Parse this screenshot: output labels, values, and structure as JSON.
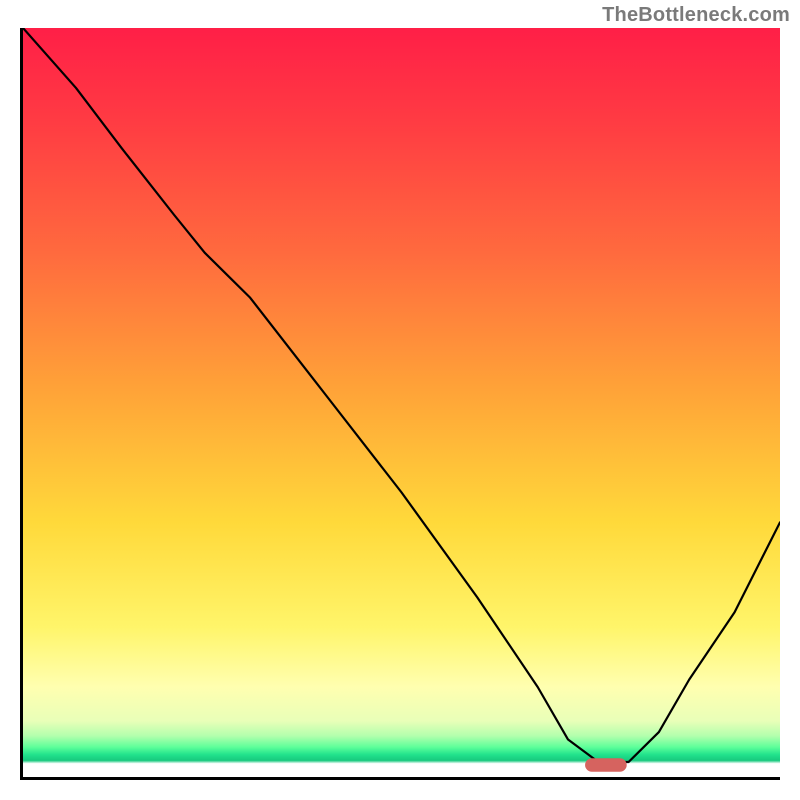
{
  "attribution": "TheBottleneck.com",
  "chart_data": {
    "type": "line",
    "title": "",
    "xlabel": "",
    "ylabel": "",
    "xlim": [
      0,
      100
    ],
    "ylim": [
      0,
      100
    ],
    "series": [
      {
        "name": "bottleneck-curve",
        "x": [
          0,
          7,
          13,
          20,
          24,
          27,
          30,
          40,
          50,
          60,
          68,
          72,
          76,
          80,
          84,
          88,
          94,
          100
        ],
        "y": [
          100,
          92,
          84,
          75,
          70,
          67,
          64,
          51,
          38,
          24,
          12,
          5,
          2,
          2,
          6,
          13,
          22,
          34
        ]
      }
    ],
    "marker": {
      "name": "optimal-point",
      "x": 77,
      "y": 1.6,
      "style": "pill",
      "color": "#d6635f"
    },
    "background_gradient": {
      "orientation": "vertical",
      "stops": [
        {
          "pos": 0.0,
          "color": "#ff1f47"
        },
        {
          "pos": 0.3,
          "color": "#ff6a3e"
        },
        {
          "pos": 0.66,
          "color": "#ffd93a"
        },
        {
          "pos": 0.88,
          "color": "#ffffb0"
        },
        {
          "pos": 0.96,
          "color": "#5eff9a"
        },
        {
          "pos": 0.978,
          "color": "#17c97e"
        },
        {
          "pos": 1.0,
          "color": "#ffffff"
        }
      ]
    }
  }
}
